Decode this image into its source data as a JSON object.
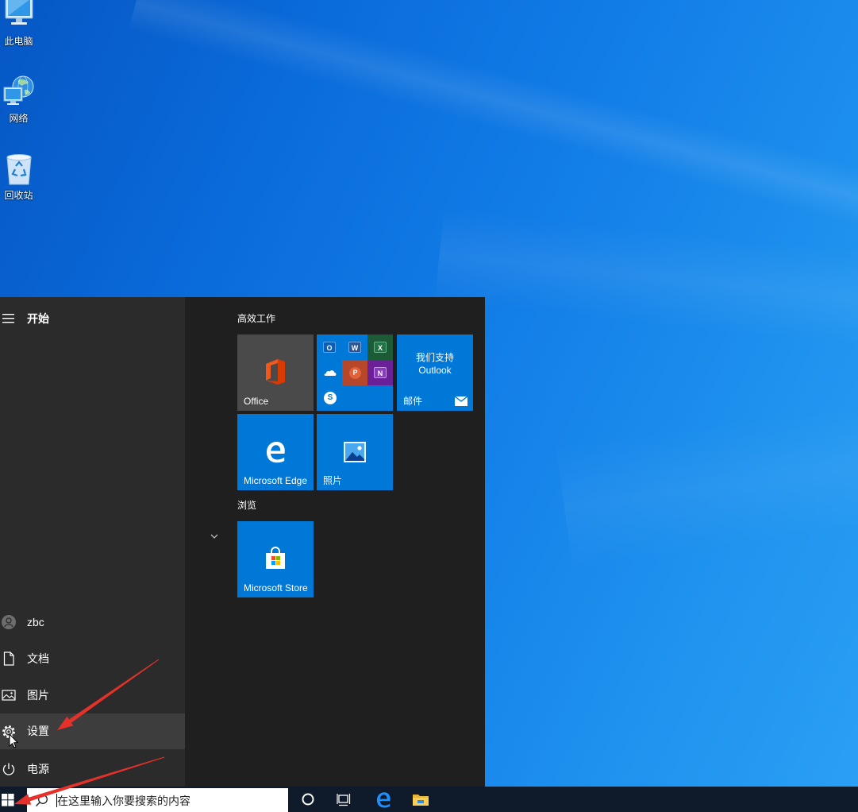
{
  "colors": {
    "accent": "#0078d7",
    "start_left": "#2b2b2b",
    "start_right": "#1f1f1f",
    "highlight": "#3d3d3d",
    "taskbar": "#0f1b2a",
    "office_tile": "#4a4a4a",
    "annotation_arrow": "#e5312a"
  },
  "desktop": {
    "icons": [
      {
        "label": "此电脑",
        "icon": "this-pc-icon"
      },
      {
        "label": "网络",
        "icon": "network-icon"
      },
      {
        "label": "回收站",
        "icon": "recycle-bin-icon"
      }
    ]
  },
  "start_menu": {
    "title": "开始",
    "user": {
      "name": "zbc",
      "icon": "avatar-icon"
    },
    "places": [
      {
        "label": "文档",
        "icon": "document-icon"
      },
      {
        "label": "图片",
        "icon": "pictures-icon"
      },
      {
        "label": "设置",
        "icon": "gear-icon",
        "highlighted": true
      },
      {
        "label": "电源",
        "icon": "power-icon"
      }
    ],
    "groups": [
      {
        "label": "高效工作"
      },
      {
        "label": "浏览"
      }
    ],
    "tiles": {
      "office": {
        "label": "Office",
        "icon": "office-logo-icon"
      },
      "office_apps": {
        "apps": [
          {
            "name": "outlook",
            "glyph": "O",
            "color": "#0a5fb4"
          },
          {
            "name": "word",
            "glyph": "W",
            "color": "#2b5797"
          },
          {
            "name": "excel",
            "glyph": "X",
            "color": "#217346"
          },
          {
            "name": "onedrive",
            "glyph": "",
            "color": "#0078d7"
          },
          {
            "name": "powerpoint",
            "glyph": "P",
            "color": "#c43e1c"
          },
          {
            "name": "onenote",
            "glyph": "N",
            "color": "#7719aa"
          },
          {
            "name": "skype",
            "glyph": "S",
            "color": "#00aff0"
          }
        ]
      },
      "mail": {
        "line1": "我们支持",
        "line2": "Outlook",
        "label": "邮件",
        "icon": "envelope-icon"
      },
      "edge": {
        "label": "Microsoft Edge",
        "icon": "edge-icon"
      },
      "photos": {
        "label": "照片",
        "icon": "photos-icon"
      },
      "store": {
        "label": "Microsoft Store",
        "icon": "store-bag-icon"
      }
    }
  },
  "taskbar": {
    "search": {
      "placeholder": "在这里输入你要搜索的内容",
      "icon": "search-icon"
    },
    "icons": [
      "windows-logo-icon",
      "cortana-icon",
      "task-view-icon",
      "edge-icon",
      "file-explorer-icon"
    ]
  }
}
